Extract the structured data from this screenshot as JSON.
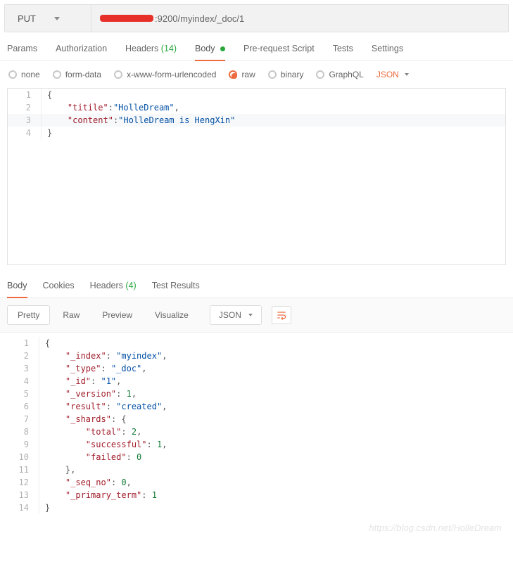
{
  "method": "PUT",
  "urlSuffix": ":9200/myindex/_doc/1",
  "reqTabs": {
    "params": "Params",
    "authorization": "Authorization",
    "headersLabel": "Headers",
    "headersCount": "(14)",
    "body": "Body",
    "prerequest": "Pre-request Script",
    "tests": "Tests",
    "settings": "Settings"
  },
  "bodyTypes": {
    "none": "none",
    "formdata": "form-data",
    "urlencoded": "x-www-form-urlencoded",
    "raw": "raw",
    "binary": "binary",
    "graphql": "GraphQL"
  },
  "bodyFormat": "JSON",
  "reqGutter": [
    "1",
    "2",
    "3",
    "4"
  ],
  "reqBody": {
    "keyTitle": "\"titile\"",
    "valTitle": "\"HolleDream\"",
    "keyContent": "\"content\"",
    "valContent": "\"HolleDream is HengXin\""
  },
  "resTabs": {
    "body": "Body",
    "cookies": "Cookies",
    "headersLabel": "Headers",
    "headersCount": "(4)",
    "testResults": "Test Results"
  },
  "resToolbar": {
    "pretty": "Pretty",
    "raw": "Raw",
    "preview": "Preview",
    "visualize": "Visualize",
    "type": "JSON"
  },
  "resGutter": [
    "1",
    "2",
    "3",
    "4",
    "5",
    "6",
    "7",
    "8",
    "9",
    "10",
    "11",
    "12",
    "13",
    "14"
  ],
  "resBody": {
    "index": {
      "k": "\"_index\"",
      "v": "\"myindex\""
    },
    "type": {
      "k": "\"_type\"",
      "v": "\"_doc\""
    },
    "id": {
      "k": "\"_id\"",
      "v": "\"1\""
    },
    "version": {
      "k": "\"_version\"",
      "v": "1"
    },
    "result": {
      "k": "\"result\"",
      "v": "\"created\""
    },
    "shards": {
      "k": "\"_shards\""
    },
    "total": {
      "k": "\"total\"",
      "v": "2"
    },
    "successful": {
      "k": "\"successful\"",
      "v": "1"
    },
    "failed": {
      "k": "\"failed\"",
      "v": "0"
    },
    "seqno": {
      "k": "\"_seq_no\"",
      "v": "0"
    },
    "primary": {
      "k": "\"_primary_term\"",
      "v": "1"
    }
  },
  "watermark": "https://blog.csdn.net/HolleDream"
}
